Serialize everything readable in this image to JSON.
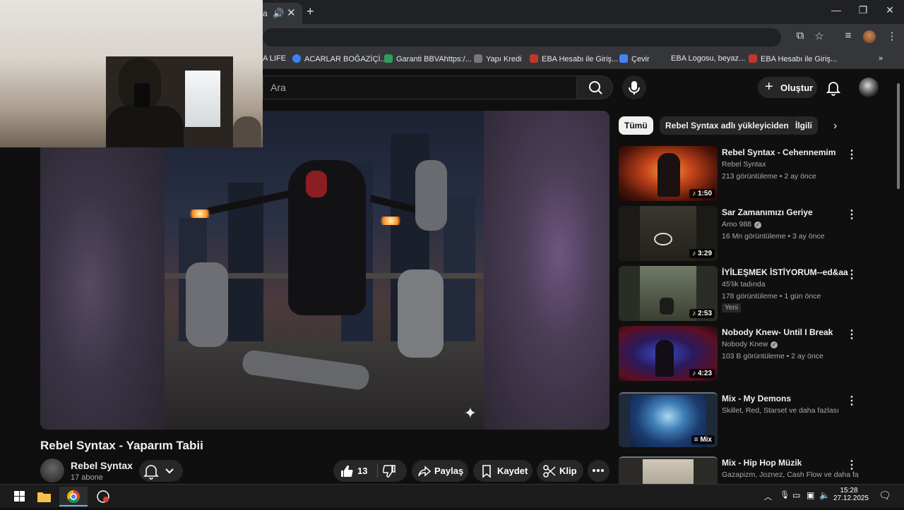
{
  "browser": {
    "tab_title": "a",
    "bookmarks": [
      "A LIFE",
      "ACARLAR BOĞAZİÇİ...",
      "Garanti BBVAhttps:/...",
      "Yapı Kredi",
      "EBA Hesabı ile Giriş...",
      "Çevir",
      "EBA Logosu, beyaz...",
      "EBA Hesabı ile Giriş..."
    ]
  },
  "header": {
    "search_placeholder": "Ara",
    "create_label": "Oluştur"
  },
  "video": {
    "title": "Rebel Syntax - Yaparım Tabii",
    "channel": "Rebel Syntax",
    "subscribers": "17 abone",
    "likes": "13",
    "share_label": "Paylaş",
    "save_label": "Kaydet",
    "clip_label": "Klip"
  },
  "sidebar": {
    "chips": [
      "Tümü",
      "Rebel Syntax adlı yükleyiciden",
      "İlgili"
    ],
    "items": [
      {
        "title": "Rebel Syntax - Cehennemim",
        "channel": "Rebel Syntax",
        "meta": "213 görüntüleme • 2 ay önce",
        "duration": "1:50",
        "badge": ""
      },
      {
        "title": "Sar Zamanımızı Geriye",
        "channel": "Amo 988",
        "meta": "16 Mn görüntüleme • 3 ay önce",
        "duration": "3:29",
        "badge": ""
      },
      {
        "title": "İYİLEŞMEK İSTİYORUM--ed&aa",
        "channel": "45'lik tadında",
        "meta": "178 görüntüleme • 1 gün önce",
        "duration": "2:53",
        "badge": "Yeni"
      },
      {
        "title": "Nobody Knew- Until I Break",
        "channel": "Nobody Knew",
        "meta": "103 B görüntüleme • 2 ay önce",
        "duration": "4:23",
        "badge": ""
      },
      {
        "title": "Mix - My Demons",
        "channel": "Skillet, Red, Starset ve daha fazlası",
        "meta": "",
        "duration": "Mix",
        "badge": ""
      },
      {
        "title": "Mix - Hip Hop Müzik",
        "channel": "Gazapizm, Joznez, Cash Flow ve daha fa",
        "meta": "",
        "duration": "",
        "badge": ""
      }
    ]
  },
  "taskbar": {
    "time": "15:28",
    "date": "27.12.2025"
  },
  "colors": {
    "background": "#0f0f0f",
    "surface": "#272727",
    "text_secondary": "#aaaaaa",
    "accent_red": "#e0245e"
  }
}
